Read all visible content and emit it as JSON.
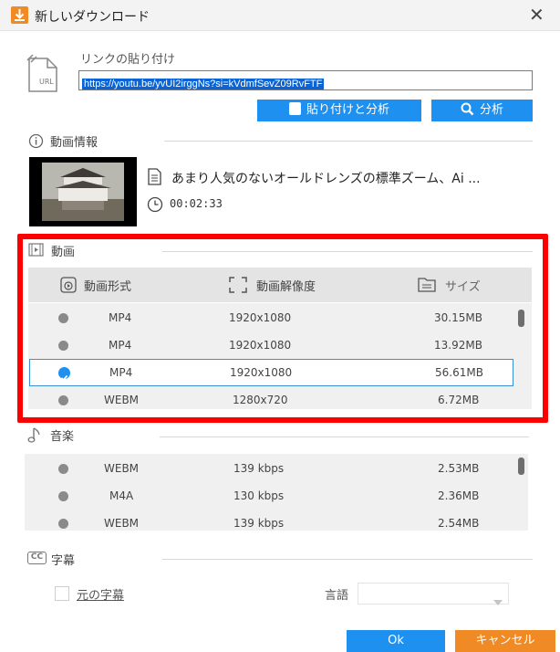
{
  "window": {
    "title": "新しいダウンロード"
  },
  "url_section": {
    "label": "リンクの貼り付け",
    "url_value": "https://youtu.be/yvUI2irggNs?si=kVdmfSevZ09RvFTF",
    "url_icon_text": "URL",
    "paste_button": "貼り付けと分析",
    "analyze_button": "分析"
  },
  "video_info": {
    "section_title": "動画情報",
    "title": "あまり人気のないオールドレンズの標準ズーム、Ai ...",
    "duration": "00:02:33"
  },
  "video_section": {
    "section_title": "動画",
    "headers": {
      "format": "動画形式",
      "resolution": "動画解像度",
      "size": "サイズ"
    },
    "rows": [
      {
        "format": "MP4",
        "resolution": "1920x1080",
        "size": "30.15MB",
        "selected": false
      },
      {
        "format": "MP4",
        "resolution": "1920x1080",
        "size": "13.92MB",
        "selected": false
      },
      {
        "format": "MP4",
        "resolution": "1920x1080",
        "size": "56.61MB",
        "selected": true
      },
      {
        "format": "WEBM",
        "resolution": "1280x720",
        "size": "6.72MB",
        "selected": false
      }
    ]
  },
  "audio_section": {
    "section_title": "音楽",
    "rows": [
      {
        "format": "WEBM",
        "bitrate": "139 kbps",
        "size": "2.53MB"
      },
      {
        "format": "M4A",
        "bitrate": "130 kbps",
        "size": "2.36MB"
      },
      {
        "format": "WEBM",
        "bitrate": "139 kbps",
        "size": "2.54MB"
      }
    ]
  },
  "subtitle_section": {
    "section_title": "字幕",
    "cc_icon_text": "CC",
    "original_subtitle_label": "元の字幕",
    "language_label": "言語",
    "language_value": ""
  },
  "footer": {
    "ok_button": "Ok",
    "cancel_button": "キャンセル"
  },
  "colors": {
    "accent": "#1e90f0",
    "cancel": "#f08a24",
    "highlight_frame": "#ff0000"
  }
}
